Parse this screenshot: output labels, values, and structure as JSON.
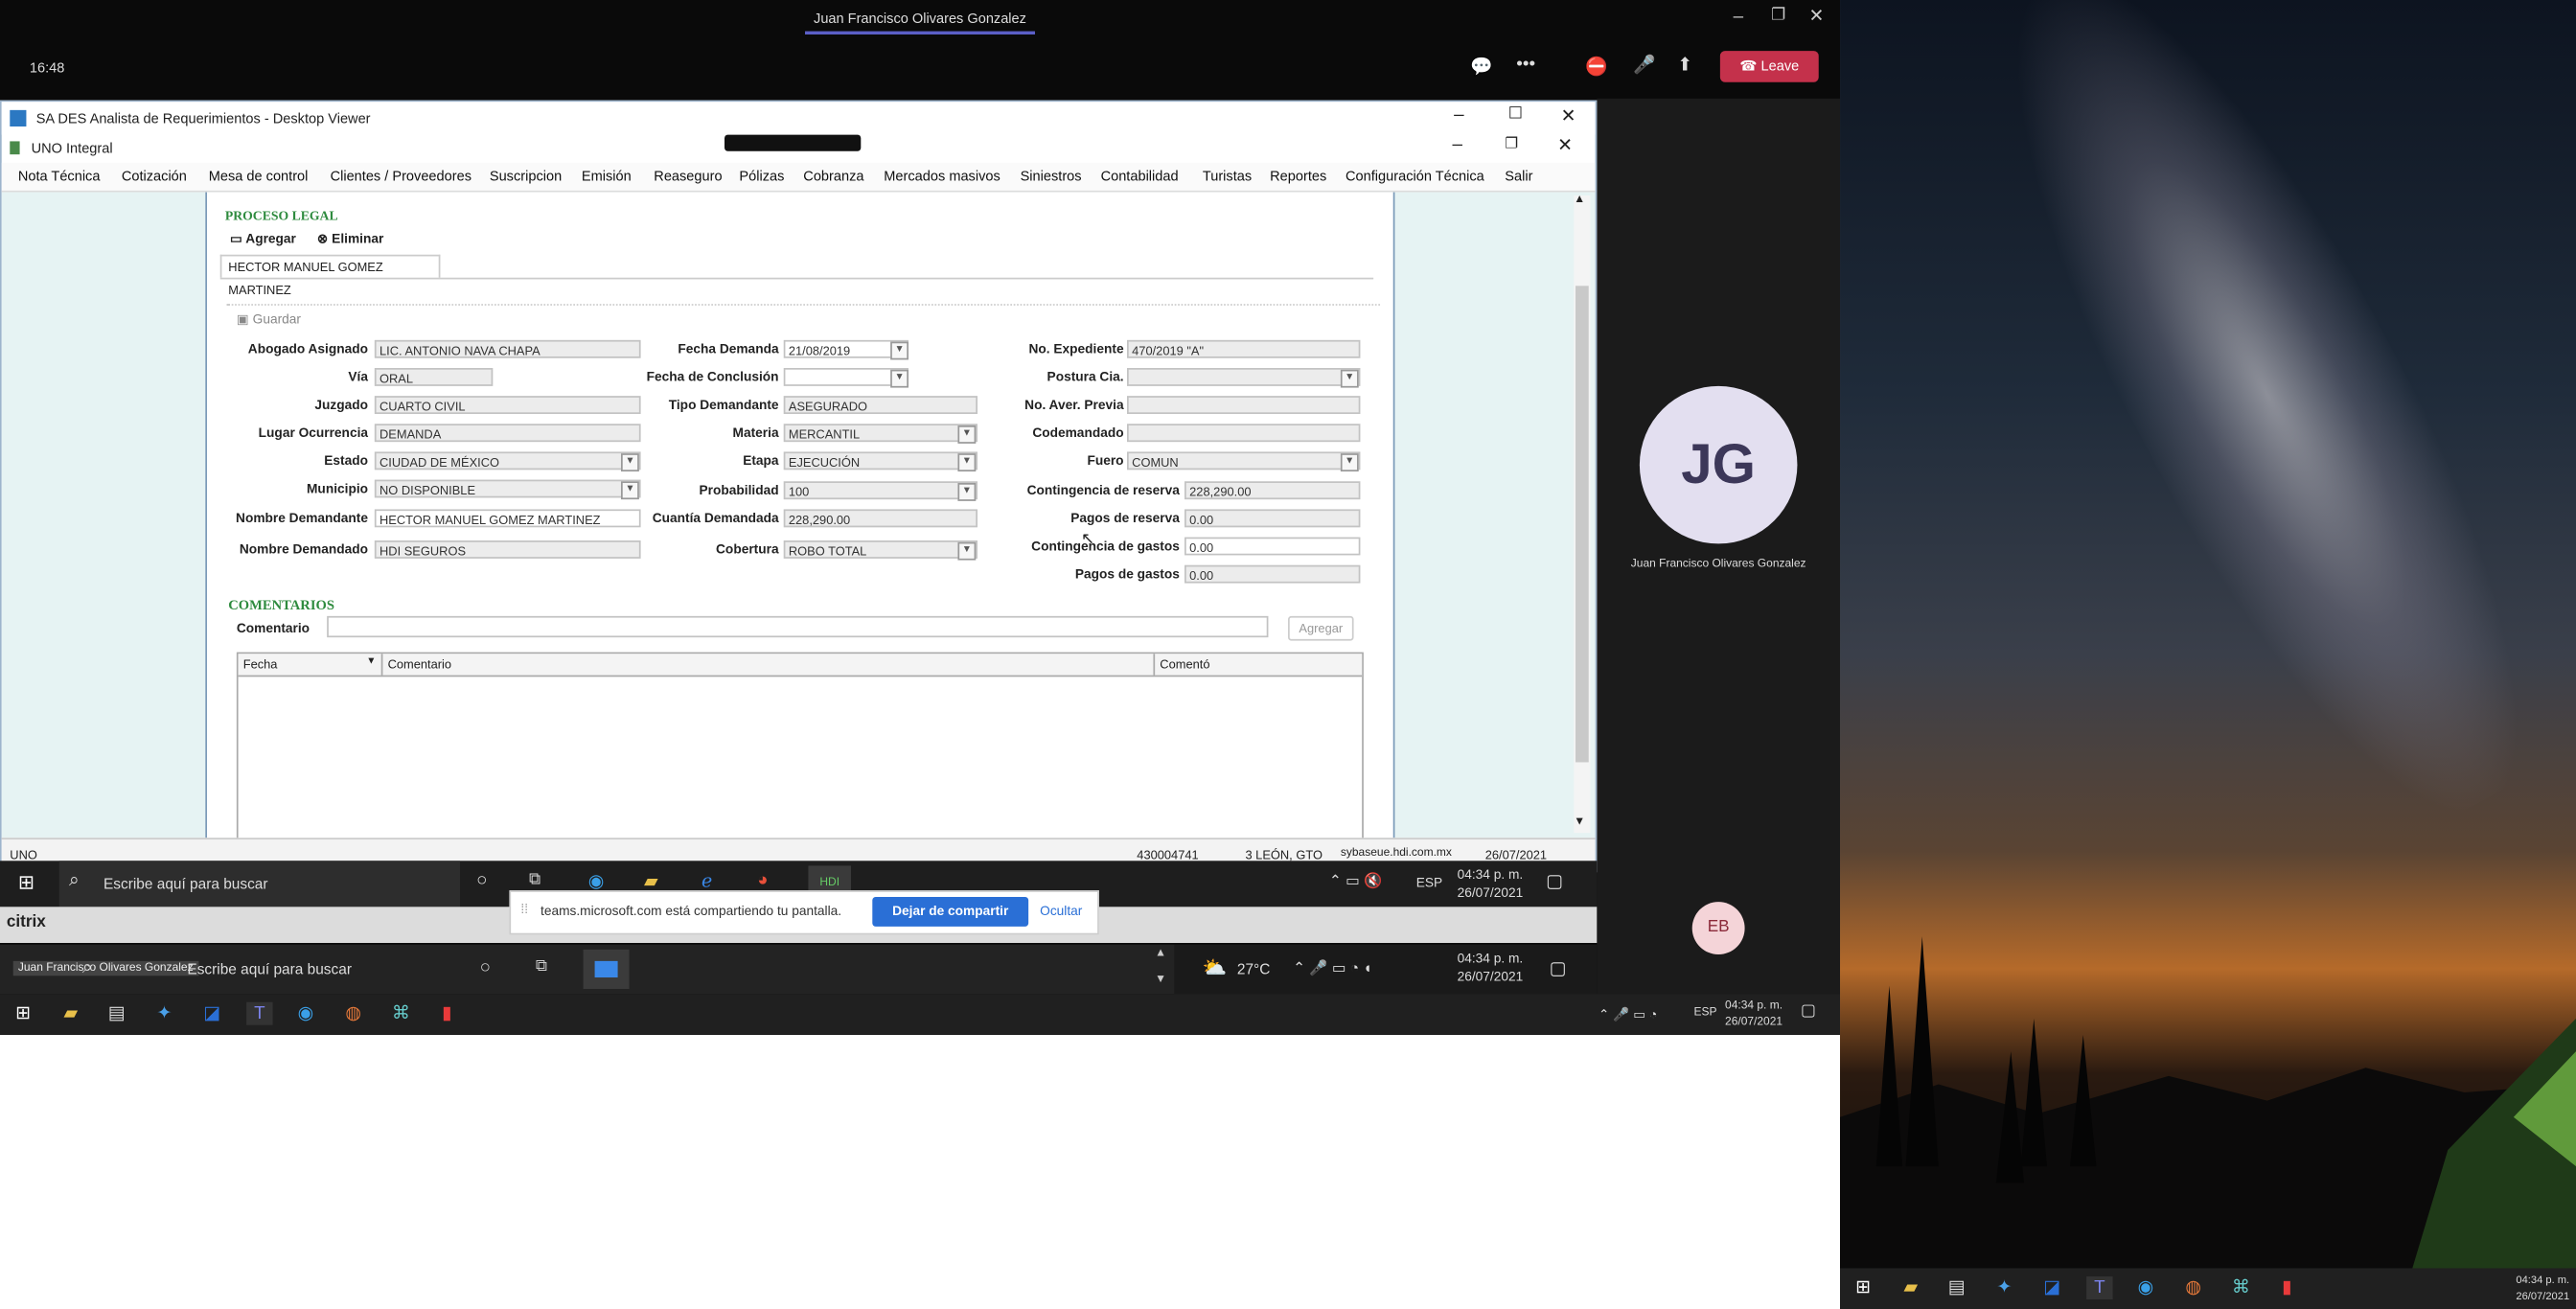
{
  "teams": {
    "window_title": "Juan Francisco Olivares Gonzalez",
    "time": "16:48",
    "leave_label": "Leave",
    "participant_initials": "JG",
    "participant_name": "Juan Francisco Olivares Gonzalez",
    "other_initials": "EB",
    "accent": "#c4314b"
  },
  "viewer": {
    "window_title": "SA DES Analista de Requerimientos - Desktop Viewer",
    "app_title": "UNO Integral"
  },
  "menu": [
    "Nota Técnica",
    "Cotización",
    "Mesa de control",
    "Clientes / Proveedores",
    "Suscripcion",
    "Emisión",
    "Reaseguro",
    "Pólizas",
    "Cobranza",
    "Mercados masivos",
    "Siniestros",
    "Contabilidad",
    "Turistas",
    "Reportes",
    "Configuración Técnica",
    "Salir"
  ],
  "form": {
    "section_title": "PROCESO LEGAL",
    "add_label": "Agregar",
    "delete_label": "Eliminar",
    "tab_label": "HECTOR MANUEL GOMEZ MARTINEZ",
    "save_label": "Guardar",
    "fields": {
      "abogado_label": "Abogado Asignado",
      "abogado": "LIC. ANTONIO NAVA CHAPA",
      "via_label": "Vía",
      "via": "ORAL",
      "juzgado_label": "Juzgado",
      "juzgado": "CUARTO CIVIL",
      "lugar_label": "Lugar Ocurrencia",
      "lugar": "DEMANDA",
      "estado_label": "Estado",
      "estado": "CIUDAD DE MÉXICO",
      "municipio_label": "Municipio",
      "municipio": "NO DISPONIBLE",
      "demandante_label": "Nombre Demandante",
      "demandante": "HECTOR MANUEL GOMEZ MARTINEZ",
      "demandado_label": "Nombre Demandado",
      "demandado": "HDI SEGUROS",
      "fecha_demanda_label": "Fecha Demanda",
      "fecha_demanda": "21/08/2019",
      "fecha_conclusion_label": "Fecha de Conclusión",
      "fecha_conclusion": "",
      "tipo_demandante_label": "Tipo Demandante",
      "tipo_demandante": "ASEGURADO",
      "materia_label": "Materia",
      "materia": "MERCANTIL",
      "etapa_label": "Etapa",
      "etapa": "EJECUCIÓN",
      "probabilidad_label": "Probabilidad",
      "probabilidad": "100",
      "cuantia_label": "Cuantía Demandada",
      "cuantia": "228,290.00",
      "cobertura_label": "Cobertura",
      "cobertura": "ROBO TOTAL",
      "expediente_label": "No. Expediente",
      "expediente": "470/2019 \"A\"",
      "postura_label": "Postura Cia.",
      "postura": "",
      "aver_label": "No. Aver. Previa",
      "aver": "",
      "codemandado_label": "Codemandado",
      "codemandado": "",
      "fuero_label": "Fuero",
      "fuero": "COMUN",
      "contingencia_reserva_label": "Contingencia de reserva",
      "contingencia_reserva": "228,290.00",
      "pagos_reserva_label": "Pagos de reserva",
      "pagos_reserva": "0.00",
      "contingencia_gastos_label": "Contingencia de gastos",
      "contingencia_gastos": "0.00",
      "pagos_gastos_label": "Pagos de gastos",
      "pagos_gastos": "0.00"
    },
    "comments_title": "COMENTARIOS",
    "comment_label": "Comentario",
    "comment_value": "",
    "comment_add_label": "Agregar",
    "table_headers": [
      "Fecha",
      "Comentario",
      "Comentó"
    ]
  },
  "statusbar": {
    "left": "UNO",
    "policy": "430004741",
    "office": "3 LEÓN, GTO",
    "server": "sybaseue.hdi.com.mx",
    "date": "26/07/2021"
  },
  "remote_taskbar": {
    "search_placeholder": "Escribe aquí para buscar",
    "lang": "ESP",
    "time": "04:34 p. m.",
    "date": "26/07/2021"
  },
  "share_popup": {
    "text": "teams.microsoft.com está compartiendo tu pantalla.",
    "stop_label": "Dejar de compartir",
    "hide_label": "Ocultar"
  },
  "citrix": {
    "logo": "citrix"
  },
  "local_taskbar": {
    "user_chip": "Juan Francisco Olivares Gonzalez",
    "search_placeholder": "Escribe aquí para buscar",
    "weather": "27°C",
    "time": "04:34 p. m.",
    "date": "26/07/2021"
  },
  "main_taskbar": {
    "lang": "ESP",
    "time": "04:34 p. m.",
    "date": "26/07/2021"
  },
  "second_taskbar": {
    "time": "04:34 p. m.",
    "date": "26/07/2021"
  }
}
